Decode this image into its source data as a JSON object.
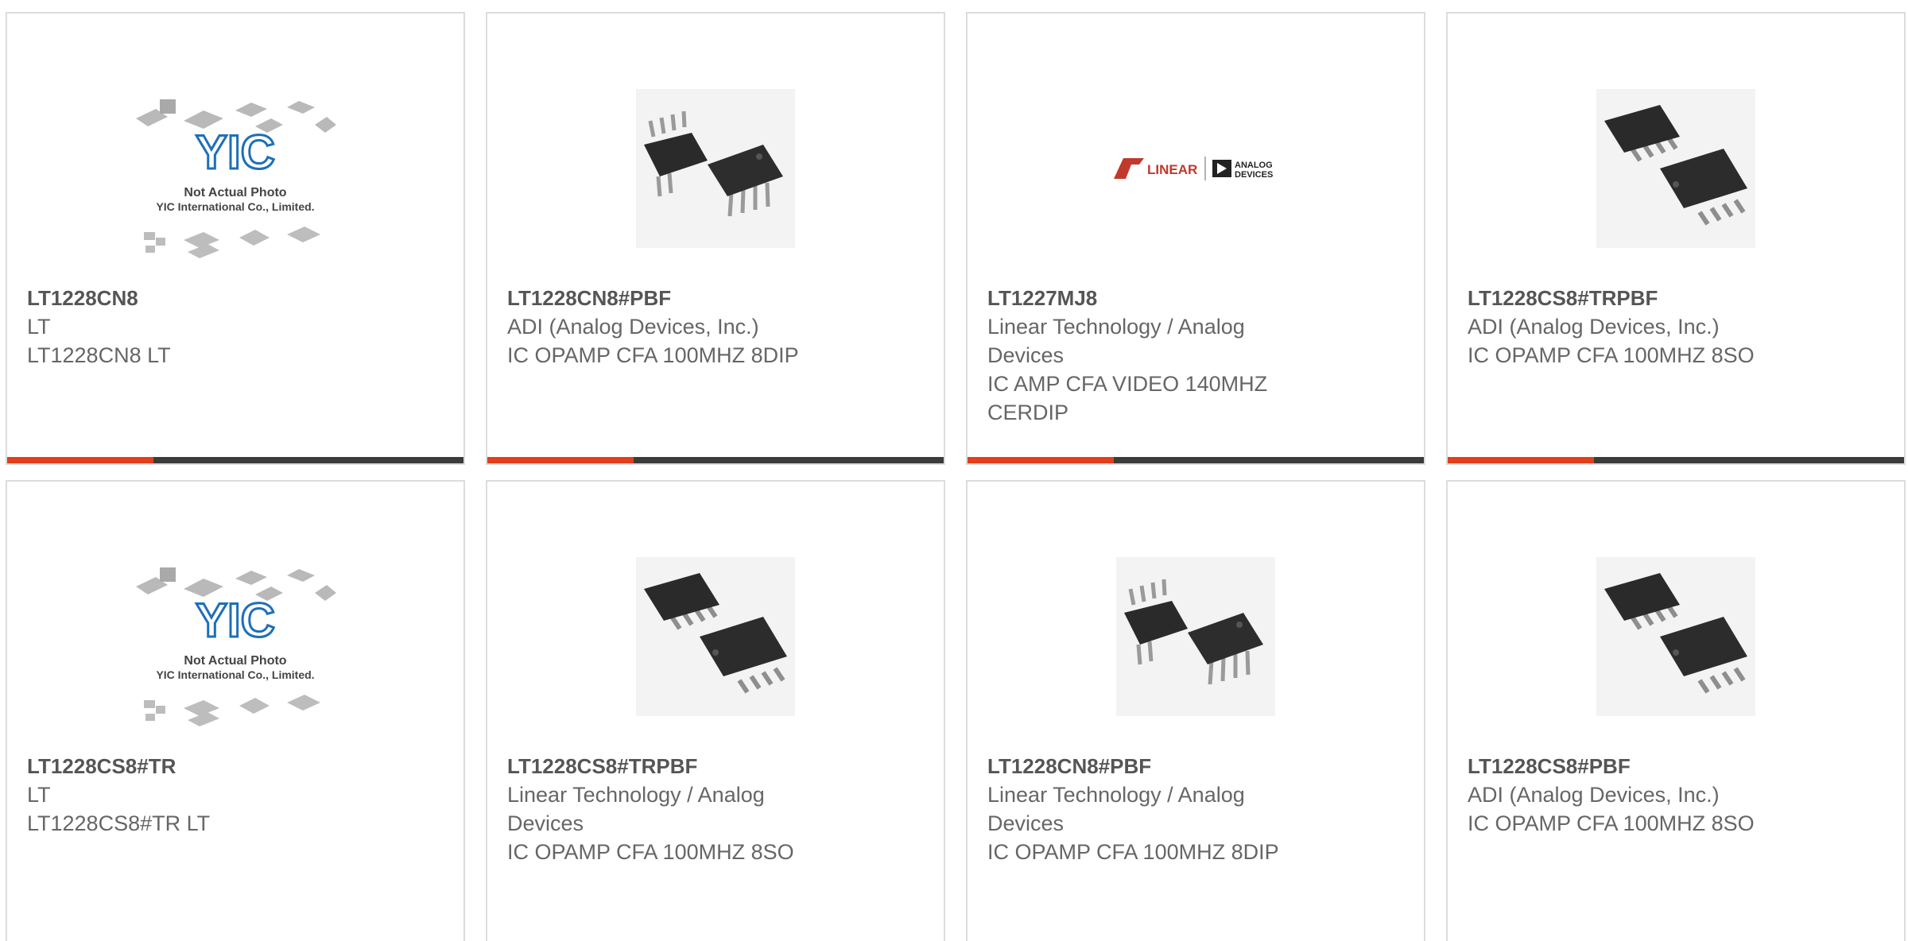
{
  "products": [
    {
      "part": "LT1228CN8",
      "maker": "LT",
      "desc": "LT1228CN8 LT",
      "image": "yic-placeholder",
      "placeholder": {
        "line1": "Not Actual Photo",
        "line2": "YIC International Co., Limited.",
        "logo": "YIC"
      }
    },
    {
      "part": "LT1228CN8#PBF",
      "maker": "ADI (Analog Devices, Inc.)",
      "desc": "IC OPAMP CFA 100MHZ 8DIP",
      "image": "dip8-chip-photo"
    },
    {
      "part": "LT1227MJ8",
      "maker": "Linear Technology / Analog Devices",
      "desc": "IC AMP CFA VIDEO 140MHZ CERDIP",
      "image": "linear-adi-logo",
      "logo": {
        "left": "LINEAR",
        "right_top": "ANALOG",
        "right_bottom": "DEVICES"
      }
    },
    {
      "part": "LT1228CS8#TRPBF",
      "maker": "ADI (Analog Devices, Inc.)",
      "desc": "IC OPAMP CFA 100MHZ 8SO",
      "image": "so8-chip-photo"
    },
    {
      "part": "LT1228CS8#TR",
      "maker": "LT",
      "desc": "LT1228CS8#TR LT",
      "image": "yic-placeholder",
      "placeholder": {
        "line1": "Not Actual Photo",
        "line2": "YIC International Co., Limited.",
        "logo": "YIC"
      }
    },
    {
      "part": "LT1228CS8#TRPBF",
      "maker": "Linear Technology / Analog Devices",
      "desc": "IC OPAMP CFA 100MHZ 8SO",
      "image": "so8-chip-photo"
    },
    {
      "part": "LT1228CN8#PBF",
      "maker": "Linear Technology / Analog Devices",
      "desc": "IC OPAMP CFA 100MHZ 8DIP",
      "image": "dip8-chip-photo"
    },
    {
      "part": "LT1228CS8#PBF",
      "maker": "ADI (Analog Devices, Inc.)",
      "desc": "IC OPAMP CFA 100MHZ 8SO",
      "image": "so8-chip-photo"
    }
  ],
  "colors": {
    "accent": "#e0401c",
    "bar": "#3b3b3b",
    "border": "#dcdcdc",
    "yic_blue": "#1e6fb8"
  }
}
